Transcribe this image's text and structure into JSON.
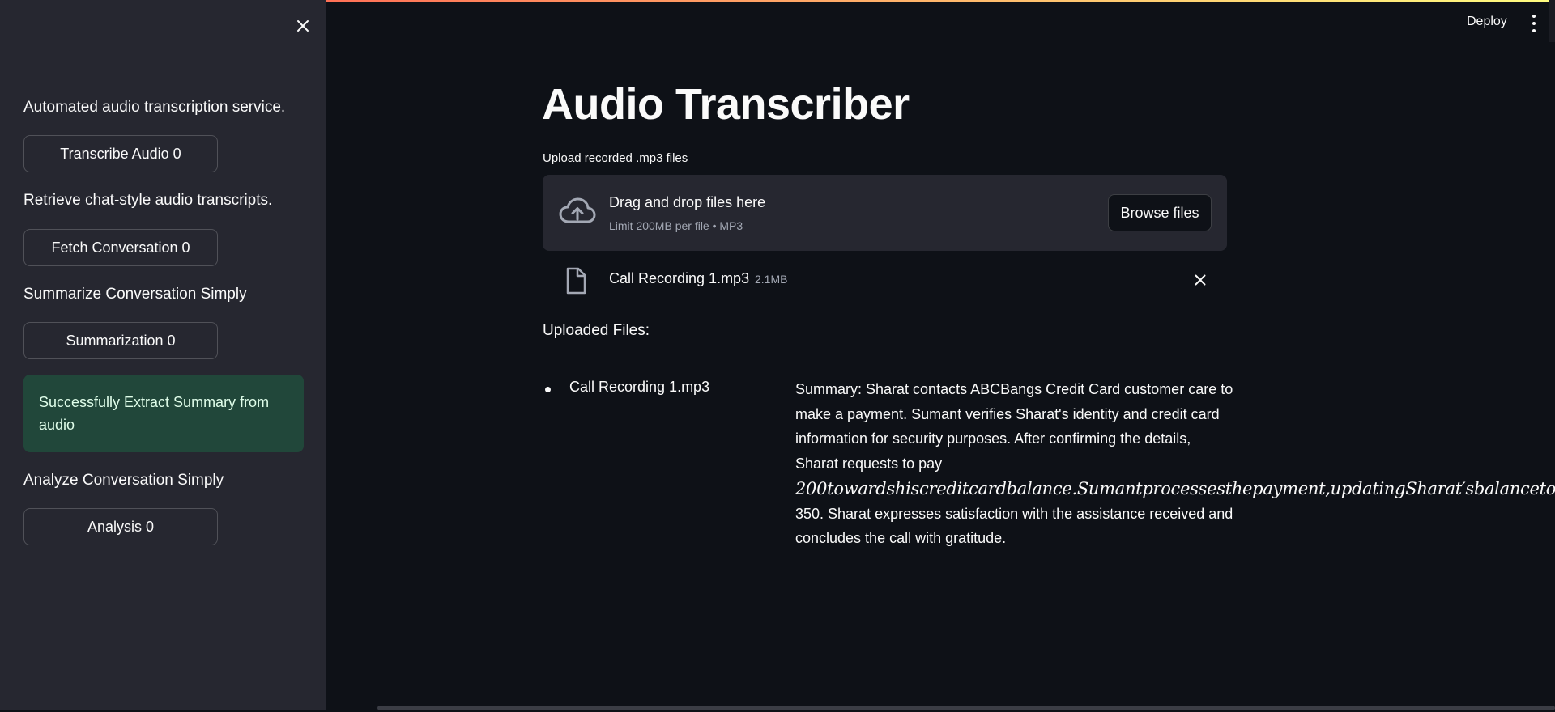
{
  "sidebar": {
    "description_1": "Automated audio transcription service.",
    "button_1": "Transcribe Audio 0",
    "description_2": "Retrieve chat-style audio transcripts.",
    "button_2": "Fetch Conversation 0",
    "description_3": "Summarize Conversation Simply",
    "button_3": "Summarization 0",
    "success_message": "Successfully Extract Summary from audio",
    "description_4": "Analyze Conversation Simply",
    "button_4": "Analysis 0"
  },
  "header": {
    "deploy_label": "Deploy"
  },
  "main": {
    "title": "Audio Transcriber",
    "upload_label": "Upload recorded .mp3 files",
    "dropzone": {
      "main_text": "Drag and drop files here",
      "sub_text": "Limit 200MB per file • MP3",
      "browse_label": "Browse files"
    },
    "uploaded_file": {
      "name": "Call Recording 1.mp3",
      "size": "2.1MB"
    },
    "uploaded_heading": "Uploaded Files:",
    "results": [
      {
        "file": "Call Recording 1.mp3",
        "summary_lines": [
          "Summary: Sharat contacts ABCBangs Credit Card customer care to",
          "make a payment. Sumant verifies Sharat's identity and credit card",
          "information for security purposes. After confirming the details,",
          "Sharat requests to pay",
          "200towardshiscreditcardbalance.Sumantprocessesthepayment,updatingSharat′sbalanceto",
          "350. Sharat expresses satisfaction with the assistance received and",
          "concludes the call with gratitude."
        ]
      }
    ]
  },
  "colors": {
    "background": "#0e1117",
    "sidebar": "#262730",
    "success_bg": "#21473a",
    "accent_gradient_start": "#ff4b4b",
    "accent_gradient_end": "#fffd80"
  }
}
